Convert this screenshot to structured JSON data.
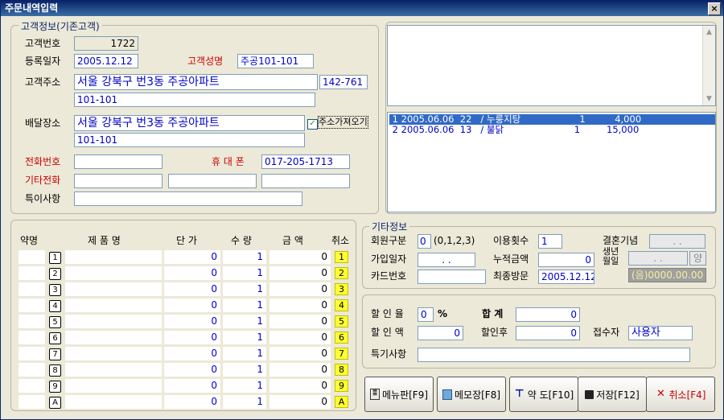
{
  "window": {
    "title": "주문내역입력",
    "close": "×"
  },
  "customer": {
    "legend": "고객정보(기존고객)",
    "id_label": "고객번호",
    "id_value": "1722",
    "reg_label": "등록일자",
    "reg_value": "2005.12.12",
    "name_label": "고객성명",
    "name_value": "주공101-101",
    "addr_label": "고객주소",
    "addr_line1": "서울 강북구 번3동 주공아파트",
    "zip": "142-761",
    "addr_line2": "101-101",
    "delivery_label": "배달장소",
    "delivery_line1": "서울 강북구 번3동 주공아파트",
    "delivery_line2": "101-101",
    "copy_addr_label": "주소가져오기",
    "copy_addr_checked": "✓",
    "phone_label": "전화번호",
    "phone_value": "",
    "mobile_label": "휴 대 폰",
    "mobile_value": "017-205-1713",
    "other_phone_label": "기타전화",
    "note_label": "특이사항"
  },
  "history": [
    {
      "text": " 1 2005.06.06  22   / 누룽지탕                    1          4,000"
    },
    {
      "text": " 2 2005.06.06  13   / 불닭                        1         15,000"
    }
  ],
  "order_table": {
    "headers": {
      "abbr": "약명",
      "name": "제  품  명",
      "price": "단  가",
      "qty": "수  량",
      "amount": "금    액",
      "cancel": "취소"
    },
    "rows": [
      {
        "key": "1",
        "price": "0",
        "qty": "1",
        "amount": "0",
        "cancel": "1"
      },
      {
        "key": "2",
        "price": "0",
        "qty": "1",
        "amount": "0",
        "cancel": "2"
      },
      {
        "key": "3",
        "price": "0",
        "qty": "1",
        "amount": "0",
        "cancel": "3"
      },
      {
        "key": "4",
        "price": "0",
        "qty": "1",
        "amount": "0",
        "cancel": "4"
      },
      {
        "key": "5",
        "price": "0",
        "qty": "1",
        "amount": "0",
        "cancel": "5"
      },
      {
        "key": "6",
        "price": "0",
        "qty": "1",
        "amount": "0",
        "cancel": "6"
      },
      {
        "key": "7",
        "price": "0",
        "qty": "1",
        "amount": "0",
        "cancel": "7"
      },
      {
        "key": "8",
        "price": "0",
        "qty": "1",
        "amount": "0",
        "cancel": "8"
      },
      {
        "key": "9",
        "price": "0",
        "qty": "1",
        "amount": "0",
        "cancel": "9"
      },
      {
        "key": "A",
        "price": "0",
        "qty": "1",
        "amount": "0",
        "cancel": "A"
      }
    ]
  },
  "etc": {
    "legend": "기타정보",
    "member_type_label": "회원구분",
    "member_type_value": "0",
    "member_type_hint": "(0,1,2,3)",
    "usage_label": "이용횟수",
    "usage_value": "1",
    "anniv_label": "결혼기념",
    "anniv_value": ".  .",
    "join_label": "가입일자",
    "join_value": ".  .",
    "total_amount_label": "누적금액",
    "total_amount_value": "0",
    "birthday_label": "생년월일",
    "birthday_value": ".  .",
    "lunar": "양",
    "card_label": "카드번호",
    "last_visit_label": "최종방문",
    "last_visit_value": "2005.12.12",
    "lunar_date": "(음)0000.00.00"
  },
  "summary": {
    "discount_rate_label": "할 인 율",
    "discount_rate_value": "0",
    "percent": "%",
    "total_label": "합  계",
    "total_value": "0",
    "discount_amount_label": "할 인 액",
    "discount_amount_value": "0",
    "after_discount_label": "할인후",
    "after_discount_value": "0",
    "receiver_label": "접수자",
    "receiver_value": "사용자",
    "special_label": "특기사항"
  },
  "buttons": {
    "menu": "메뉴판[F9]",
    "memo": "메모장[F8]",
    "map": "약 도[F10]",
    "save": "저장[F12]",
    "cancel": "취소[F4]"
  },
  "colors": {
    "accent": "#316ac5",
    "label_red": "#cc0000",
    "value_blue": "#0000cc",
    "cancel_yellow": "#ffff33"
  }
}
